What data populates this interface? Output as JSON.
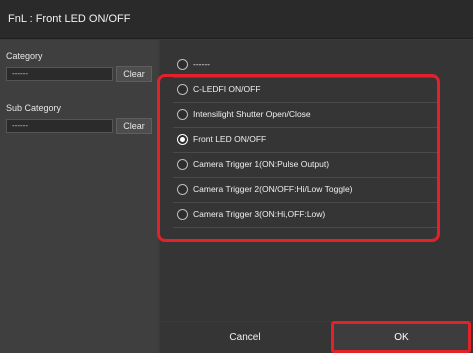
{
  "window": {
    "title": "FnL : Front LED ON/OFF"
  },
  "filters": {
    "category_label": "Category",
    "category_value": "------",
    "subcategory_label": "Sub Category",
    "subcategory_value": "------",
    "clear_label": "Clear"
  },
  "options": [
    {
      "label": "------",
      "selected": false
    },
    {
      "label": "C-LEDFI ON/OFF",
      "selected": false
    },
    {
      "label": "Intensilight Shutter Open/Close",
      "selected": false
    },
    {
      "label": "Front LED ON/OFF",
      "selected": true
    },
    {
      "label": "Camera Trigger 1(ON:Pulse Output)",
      "selected": false
    },
    {
      "label": "Camera Trigger 2(ON/OFF:Hi/Low Toggle)",
      "selected": false
    },
    {
      "label": "Camera Trigger 3(ON:Hi,OFF:Low)",
      "selected": false
    }
  ],
  "footer": {
    "cancel_label": "Cancel",
    "ok_label": "OK"
  },
  "colors": {
    "highlight": "#e4202a",
    "background": "#3a3a3a"
  }
}
